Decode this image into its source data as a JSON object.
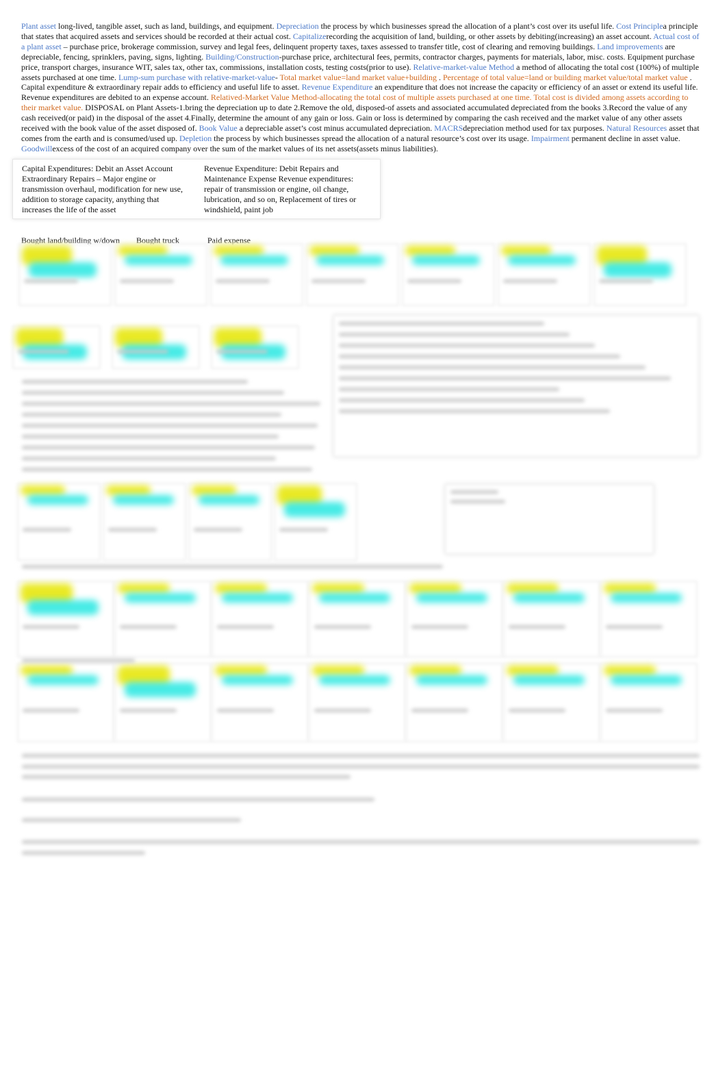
{
  "paragraph": {
    "segments": [
      {
        "style": "term",
        "text": "Plant asset"
      },
      {
        "style": "def",
        "text": " long-lived, tangible asset, such as land, buildings, and equipment.   "
      },
      {
        "style": "term",
        "text": "Depreciation"
      },
      {
        "style": "def",
        "text": " the process by which businesses spread the allocation of a plant’s cost over its useful life.    "
      },
      {
        "style": "term",
        "text": "Cost Principle"
      },
      {
        "style": "def",
        "text": "a principle that states that acquired assets and services should be recorded at their actual cost.     "
      },
      {
        "style": "term",
        "text": "Capitalize"
      },
      {
        "style": "def",
        "text": "recording the acquisition of land, building, or other assets by debiting(increasing) an asset account. "
      },
      {
        "style": "term",
        "text": "Actual cost of a plant asset"
      },
      {
        "style": "def",
        "text": " – purchase price, brokerage commission, survey and legal fees, delinquent property taxes, taxes assessed to transfer title, cost of clearing and removing buildings.      "
      },
      {
        "style": "term",
        "text": "Land improvements"
      },
      {
        "style": "def",
        "text": " are depreciable, fencing, sprinklers, paving, signs, lighting. "
      },
      {
        "style": "term",
        "text": "Building/Construction"
      },
      {
        "style": "def",
        "text": "-purchase price, architectural fees, permits, contractor charges, payments for materials, labor, misc. costs. Equipment purchase price, transport charges, insurance WIT, sales tax, other tax, commissions, installation costs, testing costs(prior to use).     "
      },
      {
        "style": "term",
        "text": "Relative-market-value Method"
      },
      {
        "style": "def",
        "text": " a method of allocating the total cost (100%) of multiple assets purchased at one time.   "
      },
      {
        "style": "term",
        "text": "Lump-sum purchase with relative-market-value"
      },
      {
        "style": "def",
        "text": "- "
      },
      {
        "style": "orange",
        "text": "Total market value=land market value+building"
      },
      {
        "style": "def",
        "text": " . "
      },
      {
        "style": "orange",
        "text": "Percentage of total value=land or building market value/total market value"
      },
      {
        "style": "def",
        "text": "  . Capital expenditure & extraordinary repair adds to efficiency and useful life to asset.  "
      },
      {
        "style": "term",
        "text": "Revenue Expenditure"
      },
      {
        "style": "def",
        "text": "  an expenditure that does not increase the capacity or efficiency of an asset or extend its useful life. Revenue expenditures are debited to an expense account.     "
      },
      {
        "style": "orange",
        "text": "Relatived-Market Value Method-allocating the total cost of multiple assets purchased at one time. Total cost is divided among assets according to their market value."
      },
      {
        "style": "def",
        "text": "   DISPOSAL on Plant Assets-1.bring the depreciation up to date 2.Remove the old, disposed-of assets and associated accumulated depreciated from the books 3.Record the value of any cash received(or paid) in the disposal of the asset 4.Finally, determine the amount of any gain or loss. Gain or loss is determined by comparing the cash received and the market value of any other assets received with the book value of the asset disposed of.     "
      },
      {
        "style": "term",
        "text": "Book Value"
      },
      {
        "style": "def",
        "text": " a depreciable asset’s cost minus accumulated depreciation.    "
      },
      {
        "style": "term",
        "text": "MACRS"
      },
      {
        "style": "def",
        "text": "depreciation method used for tax purposes.   "
      },
      {
        "style": "term",
        "text": "Natural Resources"
      },
      {
        "style": "def",
        "text": " asset that comes from the earth and is consumed/used up.    "
      },
      {
        "style": "term",
        "text": "Depletion"
      },
      {
        "style": "def",
        "text": " the process by which businesses spread the allocation of a natural resource’s cost over its usage. "
      },
      {
        "style": "term",
        "text": "Impairment"
      },
      {
        "style": "def",
        "text": "  permanent decline in asset value.   "
      },
      {
        "style": "term",
        "text": "Goodwill"
      },
      {
        "style": "def",
        "text": "excess of the cost of an acquired company over the sum of the market values of its net assets(assets minus liabilities)."
      }
    ]
  },
  "expenditures": {
    "capital": "Capital Expenditures: Debit an Asset Account Extraordinary Repairs – Major engine or transmission overhaul, modification for new use, addition to storage capacity, anything that increases the life of the asset",
    "revenue": "Revenue Expenditure: Debit Repairs and Maintenance Expense Revenue expenditures: repair of transmission or engine, oil change, lubrication, and so on, Replacement of tires or windshield, paint job"
  },
  "labels": {
    "bought_land": "Bought land/building w/down",
    "bought_truck": "Bought truck",
    "paid_expense": "Paid expense"
  },
  "colors": {
    "term": "#4a78c8",
    "orange": "#d2691e",
    "highlight_yellow": "#e6e600",
    "highlight_cyan": "#18e6e0"
  }
}
